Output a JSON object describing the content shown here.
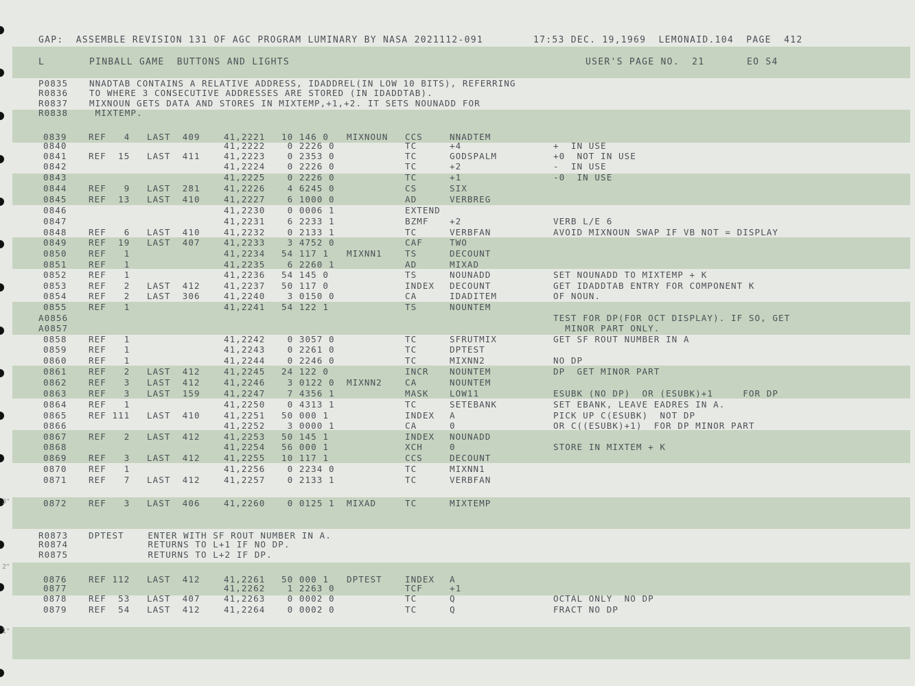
{
  "header": {
    "program_line": "GAP:  ASSEMBLE REVISION 131 OF AGC PROGRAM LUMINARY BY NASA 2021112-091",
    "timestamp_line": "17:53 DEC. 19,1969  LEMONAID.104  PAGE  412"
  },
  "subheader": {
    "code": "L",
    "title": "PINBALL GAME  BUTTONS AND LIGHTS",
    "users_page": "USER'S PAGE NO.  21",
    "tag": "EO S4"
  },
  "comment_block_1": [
    {
      "ln": "P0835",
      "text": "NNADTAB CONTAINS A RELATIVE ADDRESS, IDADDREL(IN LOW 10 BITS), REFERRING"
    },
    {
      "ln": "R0836",
      "text": "TO WHERE 3 CONSECUTIVE ADDRESSES ARE STORED (IN IDADDTAB)."
    },
    {
      "ln": "R0837",
      "text": "MIXNOUN GETS DATA AND STORES IN MIXTEMP,+1,+2. IT SETS NOUNADD FOR"
    },
    {
      "ln": "R0838",
      "text": " MIXTEMP."
    }
  ],
  "code_block_1": [
    {
      "ln": "0839",
      "ref": "REF   4",
      "last": "LAST  409",
      "addr": "41,2221",
      "word": "10 146 0",
      "label": "MIXNOUN",
      "op": "CCS",
      "operand": "NNADTEM",
      "comment": ""
    },
    {
      "ln": "0840",
      "ref": "",
      "last": "",
      "addr": "41,2222",
      "word": " 0 2226 0",
      "label": "",
      "op": "TC",
      "operand": "+4",
      "comment": "+  IN USE"
    },
    {
      "ln": "0841",
      "ref": "REF  15",
      "last": "LAST  411",
      "addr": "41,2223",
      "word": " 0 2353 0",
      "label": "",
      "op": "TC",
      "operand": "GODSPALM",
      "comment": "+0  NOT IN USE"
    },
    {
      "ln": "0842",
      "ref": "",
      "last": "",
      "addr": "41,2224",
      "word": " 0 2226 0",
      "label": "",
      "op": "TC",
      "operand": "+2",
      "comment": "-  IN USE"
    },
    {
      "ln": "0843",
      "ref": "",
      "last": "",
      "addr": "41,2225",
      "word": " 0 2226 0",
      "label": "",
      "op": "TC",
      "operand": "+1",
      "comment": "-0  IN USE"
    },
    {
      "ln": "0844",
      "ref": "REF   9",
      "last": "LAST  281",
      "addr": "41,2226",
      "word": " 4 6245 0",
      "label": "",
      "op": "CS",
      "operand": "SIX",
      "comment": ""
    },
    {
      "ln": "0845",
      "ref": "REF  13",
      "last": "LAST  410",
      "addr": "41,2227",
      "word": " 6 1000 0",
      "label": "",
      "op": "AD",
      "operand": "VERBREG",
      "comment": ""
    },
    {
      "ln": "0846",
      "ref": "",
      "last": "",
      "addr": "41,2230",
      "word": " 0 0006 1",
      "label": "",
      "op": "EXTEND",
      "operand": "",
      "comment": ""
    },
    {
      "ln": "0847",
      "ref": "",
      "last": "",
      "addr": "41,2231",
      "word": " 6 2233 1",
      "label": "",
      "op": "BZMF",
      "operand": "+2",
      "comment": "VERB L/E 6"
    },
    {
      "ln": "0848",
      "ref": "REF   6",
      "last": "LAST  410",
      "addr": "41,2232",
      "word": " 0 2133 1",
      "label": "",
      "op": "TC",
      "operand": "VERBFAN",
      "comment": "AVOID MIXNOUN SWAP IF VB NOT = DISPLAY"
    },
    {
      "ln": "0849",
      "ref": "REF  19",
      "last": "LAST  407",
      "addr": "41,2233",
      "word": " 3 4752 0",
      "label": "",
      "op": "CAF",
      "operand": "TWO",
      "comment": ""
    },
    {
      "ln": "0850",
      "ref": "REF   1",
      "last": "",
      "addr": "41,2234",
      "word": "54 117 1",
      "label": "MIXNN1",
      "op": "TS",
      "operand": "DECOUNT",
      "comment": ""
    },
    {
      "ln": "0851",
      "ref": "REF   1",
      "last": "",
      "addr": "41,2235",
      "word": " 6 2260 1",
      "label": "",
      "op": "AD",
      "operand": "MIXAD",
      "comment": ""
    },
    {
      "ln": "0852",
      "ref": "REF   1",
      "last": "",
      "addr": "41,2236",
      "word": "54 145 0",
      "label": "",
      "op": "TS",
      "operand": "NOUNADD",
      "comment": "SET NOUNADD TO MIXTEMP + K"
    },
    {
      "ln": "0853",
      "ref": "REF   2",
      "last": "LAST  412",
      "addr": "41,2237",
      "word": "50 117 0",
      "label": "",
      "op": "INDEX",
      "operand": "DECOUNT",
      "comment": "GET IDADDTAB ENTRY FOR COMPONENT K"
    },
    {
      "ln": "0854",
      "ref": "REF   2",
      "last": "LAST  306",
      "addr": "41,2240",
      "word": " 3 0150 0",
      "label": "",
      "op": "CA",
      "operand": "IDADITEM",
      "comment": "OF NOUN."
    },
    {
      "ln": "0855",
      "ref": "REF   1",
      "last": "",
      "addr": "41,2241",
      "word": "54 122 1",
      "label": "",
      "op": "TS",
      "operand": "NOUNTEM",
      "comment": ""
    },
    {
      "ln": "A0856",
      "ref": "",
      "last": "",
      "addr": "",
      "word": "",
      "label": "",
      "op": "",
      "operand": "",
      "comment": "TEST FOR DP(FOR OCT DISPLAY). IF SO, GET"
    },
    {
      "ln": "A0857",
      "ref": "",
      "last": "",
      "addr": "",
      "word": "",
      "label": "",
      "op": "",
      "operand": "",
      "comment": "  MINOR PART ONLY."
    },
    {
      "ln": "0858",
      "ref": "REF   1",
      "last": "",
      "addr": "41,2242",
      "word": " 0 3057 0",
      "label": "",
      "op": "TC",
      "operand": "SFRUTMIX",
      "comment": "GET SF ROUT NUMBER IN A"
    },
    {
      "ln": "0859",
      "ref": "REF   1",
      "last": "",
      "addr": "41,2243",
      "word": " 0 2261 0",
      "label": "",
      "op": "TC",
      "operand": "DPTEST",
      "comment": ""
    },
    {
      "ln": "0860",
      "ref": "REF   1",
      "last": "",
      "addr": "41,2244",
      "word": " 0 2246 0",
      "label": "",
      "op": "TC",
      "operand": "MIXNN2",
      "comment": "NO DP"
    },
    {
      "ln": "0861",
      "ref": "REF   2",
      "last": "LAST  412",
      "addr": "41,2245",
      "word": "24 122 0",
      "label": "",
      "op": "INCR",
      "operand": "NOUNTEM",
      "comment": "DP  GET MINOR PART"
    },
    {
      "ln": "0862",
      "ref": "REF   3",
      "last": "LAST  412",
      "addr": "41,2246",
      "word": " 3 0122 0",
      "label": "MIXNN2",
      "op": "CA",
      "operand": "NOUNTEM",
      "comment": ""
    },
    {
      "ln": "0863",
      "ref": "REF   3",
      "last": "LAST  159",
      "addr": "41,2247",
      "word": " 7 4356 1",
      "label": "",
      "op": "MASK",
      "operand": "LOW11",
      "comment": "ESUBK (NO DP)  OR (ESUBK)+1     FOR DP"
    },
    {
      "ln": "0864",
      "ref": "REF   1",
      "last": "",
      "addr": "41,2250",
      "word": " 0 4313 1",
      "label": "",
      "op": "TC",
      "operand": "SETEBANK",
      "comment": "SET EBANK, LEAVE EADRES IN A."
    },
    {
      "ln": "0865",
      "ref": "REF 111",
      "last": "LAST  410",
      "addr": "41,2251",
      "word": "50 000 1",
      "label": "",
      "op": "INDEX",
      "operand": "A",
      "comment": "PICK UP C(ESUBK)  NOT DP"
    },
    {
      "ln": "0866",
      "ref": "",
      "last": "",
      "addr": "41,2252",
      "word": " 3 0000 1",
      "label": "",
      "op": "CA",
      "operand": "0",
      "comment": "OR C((ESUBK)+1)  FOR DP MINOR PART"
    },
    {
      "ln": "0867",
      "ref": "REF   2",
      "last": "LAST  412",
      "addr": "41,2253",
      "word": "50 145 1",
      "label": "",
      "op": "INDEX",
      "operand": "NOUNADD",
      "comment": ""
    },
    {
      "ln": "0868",
      "ref": "",
      "last": "",
      "addr": "41,2254",
      "word": "56 000 1",
      "label": "",
      "op": "XCH",
      "operand": "0",
      "comment": "STORE IN MIXTEM + K"
    },
    {
      "ln": "0869",
      "ref": "REF   3",
      "last": "LAST  412",
      "addr": "41,2255",
      "word": "10 117 1",
      "label": "",
      "op": "CCS",
      "operand": "DECOUNT",
      "comment": ""
    },
    {
      "ln": "0870",
      "ref": "REF   1",
      "last": "",
      "addr": "41,2256",
      "word": " 0 2234 0",
      "label": "",
      "op": "TC",
      "operand": "MIXNN1",
      "comment": ""
    },
    {
      "ln": "0871",
      "ref": "REF   7",
      "last": "LAST  412",
      "addr": "41,2257",
      "word": " 0 2133 1",
      "label": "",
      "op": "TC",
      "operand": "VERBFAN",
      "comment": ""
    }
  ],
  "code_block_2": [
    {
      "ln": "0872",
      "ref": "REF   3",
      "last": "LAST  406",
      "addr": "41,2260",
      "word": " 0 0125 1",
      "label": "MIXAD",
      "op": "TC",
      "operand": "MIXTEMP",
      "comment": ""
    }
  ],
  "comment_block_2": [
    {
      "ln": "R0873",
      "text": "DPTEST    ENTER WITH SF ROUT NUMBER IN A."
    },
    {
      "ln": "R0874",
      "text": "          RETURNS TO L+1 IF NO DP."
    },
    {
      "ln": "R0875",
      "text": "          RETURNS TO L+2 IF DP."
    }
  ],
  "code_block_3": [
    {
      "ln": "0876",
      "ref": "REF 112",
      "last": "LAST  412",
      "addr": "41,2261",
      "word": "50 000 1",
      "label": "DPTEST",
      "op": "INDEX",
      "operand": "A",
      "comment": ""
    },
    {
      "ln": "0877",
      "ref": "",
      "last": "",
      "addr": "41,2262",
      "word": " 1 2263 0",
      "label": "",
      "op": "TCF",
      "operand": "+1",
      "comment": ""
    },
    {
      "ln": "0878",
      "ref": "REF  53",
      "last": "LAST  407",
      "addr": "41,2263",
      "word": " 0 0002 0",
      "label": "",
      "op": "TC",
      "operand": "Q",
      "comment": "OCTAL ONLY  NO DP"
    },
    {
      "ln": "0879",
      "ref": "REF  54",
      "last": "LAST  412",
      "addr": "41,2264",
      "word": " 0 0002 0",
      "label": "",
      "op": "TC",
      "operand": "Q",
      "comment": "FRACT NO DP"
    }
  ],
  "margin_marks": [
    "3\"",
    "2\"",
    "1\""
  ]
}
